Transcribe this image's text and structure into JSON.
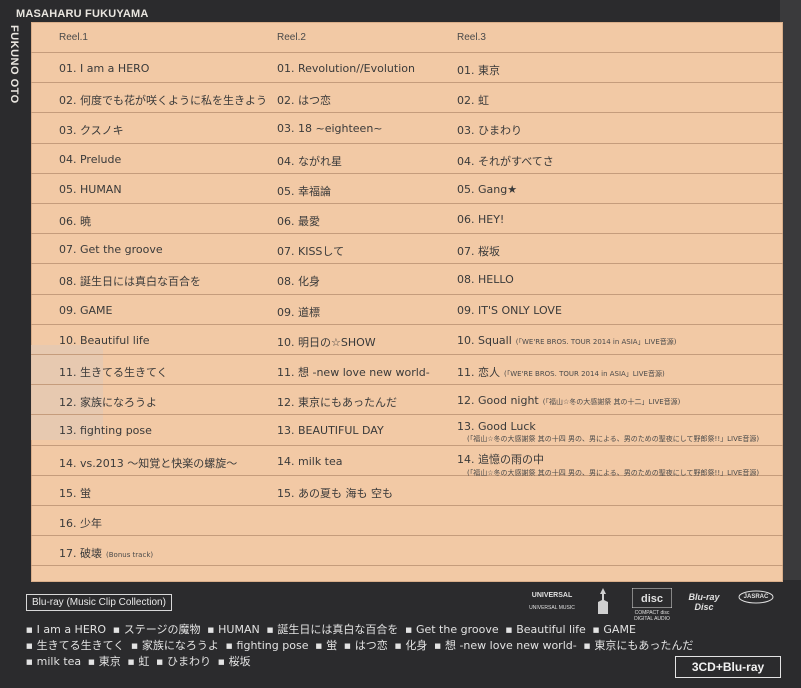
{
  "artist": "MASAHARU FUKUYAMA",
  "album": "FUKUNO OTO",
  "reels": [
    {
      "header": "Reel.1",
      "tracks": [
        {
          "t": "01. I am a HERO"
        },
        {
          "t": "02. 何度でも花が咲くように私を生きよう"
        },
        {
          "t": "03. クスノキ"
        },
        {
          "t": "04. Prelude"
        },
        {
          "t": "05. HUMAN"
        },
        {
          "t": "06. 暁"
        },
        {
          "t": "07. Get the groove"
        },
        {
          "t": "08. 誕生日には真白な百合を"
        },
        {
          "t": "09. GAME"
        },
        {
          "t": "10. Beautiful life"
        },
        {
          "t": "11. 生きてる生きてく"
        },
        {
          "t": "12. 家族になろうよ"
        },
        {
          "t": "13. fighting pose"
        },
        {
          "t": "14. vs.2013 ～知覚と快楽の螺旋～"
        },
        {
          "t": "15. 蛍"
        },
        {
          "t": "16. 少年"
        },
        {
          "t": "17. 破壊",
          "note": "(Bonus track)"
        }
      ]
    },
    {
      "header": "Reel.2",
      "tracks": [
        {
          "t": "01. Revolution//Evolution"
        },
        {
          "t": "02. はつ恋"
        },
        {
          "t": "03. 18 ~eighteen~"
        },
        {
          "t": "04. ながれ星"
        },
        {
          "t": "05. 幸福論"
        },
        {
          "t": "06. 最愛"
        },
        {
          "t": "07. KISSして"
        },
        {
          "t": "08. 化身"
        },
        {
          "t": "09. 道標"
        },
        {
          "t": "10. 明日の☆SHOW"
        },
        {
          "t": "11. 想 -new love new world-"
        },
        {
          "t": "12. 東京にもあったんだ"
        },
        {
          "t": "13. BEAUTIFUL DAY"
        },
        {
          "t": "14. milk tea"
        },
        {
          "t": "15. あの夏も 海も 空も"
        }
      ]
    },
    {
      "header": "Reel.3",
      "tracks": [
        {
          "t": "01. 東京"
        },
        {
          "t": "02. 虹"
        },
        {
          "t": "03. ひまわり"
        },
        {
          "t": "04. それがすべてさ"
        },
        {
          "t": "05. Gang★"
        },
        {
          "t": "06. HEY!"
        },
        {
          "t": "07. 桜坂"
        },
        {
          "t": "08. HELLO"
        },
        {
          "t": "09. IT'S ONLY LOVE"
        },
        {
          "t": "10. Squall",
          "note": "(「WE'RE BROS. TOUR 2014 in ASIA」LIVE音源)"
        },
        {
          "t": "11. 恋人",
          "note": "(「WE'RE BROS. TOUR 2014 in ASIA」LIVE音源)"
        },
        {
          "t": "12. Good night",
          "note": "(「福山☆冬の大感謝祭 其の十二」LIVE音源)"
        },
        {
          "t": "13. Good Luck",
          "sub": "(「福山☆冬の大感謝祭 其の十四 男の、男による、男のための聖夜にして野郎祭!!」LIVE音源)"
        },
        {
          "t": "14. 追憶の雨の中",
          "sub": "(「福山☆冬の大感謝祭 其の十四 男の、男による、男のための聖夜にして野郎祭!!」LIVE音源)"
        }
      ]
    }
  ],
  "bluray_label": "Blu-ray (Music Clip Collection)",
  "clips": [
    "I am a HERO",
    "ステージの魔物",
    "HUMAN",
    "誕生日には真白な百合を",
    "Get the groove",
    "Beautiful life",
    "GAME",
    "生きてる生きてく",
    "家族になろうよ",
    "fighting pose",
    "蛍",
    "はつ恋",
    "化身",
    "想 -new love new world-",
    "東京にもあったんだ",
    "milk tea",
    "東京",
    "虹",
    "ひまわり",
    "桜坂"
  ],
  "logos": {
    "universal": "UNIVERSAL",
    "universal_sub": "UNIVERSAL MUSIC",
    "cd": "COMPACT disc DIGITAL AUDIO",
    "bluray": "Blu-ray Disc",
    "jasrac": "JASRAC"
  },
  "format": "3CD+Blu-ray"
}
